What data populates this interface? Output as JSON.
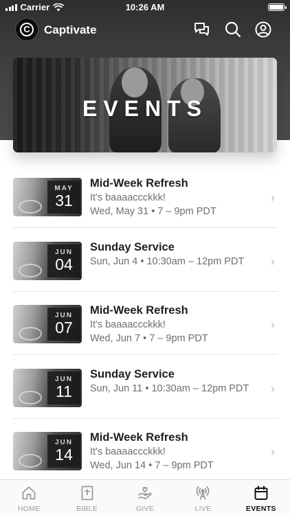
{
  "status_bar": {
    "carrier": "Carrier",
    "time": "10:26 AM"
  },
  "app": {
    "name": "Captivate",
    "logo_letter": "C"
  },
  "hero": {
    "title": "EVENTS"
  },
  "events": [
    {
      "month": "MAY",
      "day": "31",
      "title": "Mid-Week Refresh",
      "subtitle": "It's baaaaccckkk!",
      "when": "Wed, May 31 • 7 – 9pm PDT"
    },
    {
      "month": "JUN",
      "day": "04",
      "title": "Sunday Service",
      "subtitle": "",
      "when": "Sun, Jun 4 • 10:30am – 12pm PDT"
    },
    {
      "month": "JUN",
      "day": "07",
      "title": "Mid-Week Refresh",
      "subtitle": "It's baaaaccckkk!",
      "when": "Wed, Jun 7 • 7 – 9pm PDT"
    },
    {
      "month": "JUN",
      "day": "11",
      "title": "Sunday Service",
      "subtitle": "",
      "when": "Sun, Jun 11 • 10:30am – 12pm PDT"
    },
    {
      "month": "JUN",
      "day": "14",
      "title": "Mid-Week Refresh",
      "subtitle": "It's baaaaccckkk!",
      "when": "Wed, Jun 14 • 7 – 9pm PDT"
    }
  ],
  "tabs": [
    {
      "label": "HOME",
      "icon": "home-icon"
    },
    {
      "label": "BIBLE",
      "icon": "bible-icon"
    },
    {
      "label": "GIVE",
      "icon": "give-icon"
    },
    {
      "label": "LIVE",
      "icon": "live-icon"
    },
    {
      "label": "EVENTS",
      "icon": "calendar-icon",
      "active": true
    }
  ],
  "colors": {
    "header_bg": "#3a3a3a",
    "active_tab": "#111111",
    "inactive_tab": "#9a9a9a",
    "subtext": "#6e6e6e"
  }
}
